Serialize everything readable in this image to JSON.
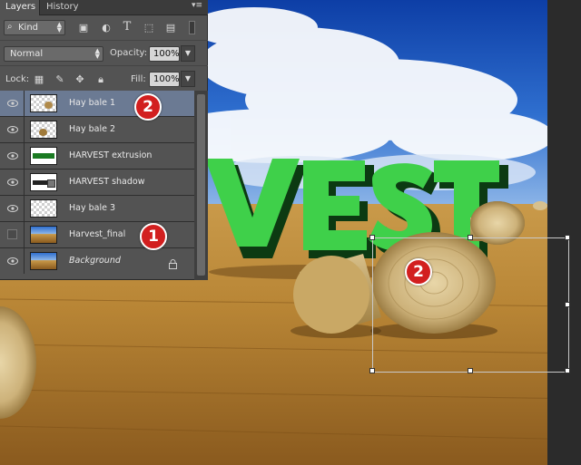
{
  "panel": {
    "tabs": [
      "Layers",
      "History"
    ],
    "menu_icon": "panel-menu-icon",
    "filter_kind": "Kind",
    "blend_mode": "Normal",
    "opacity_label": "Opacity:",
    "opacity_value": "100%",
    "lock_label": "Lock:",
    "fill_label": "Fill:",
    "fill_value": "100%"
  },
  "layers": [
    {
      "name": "Hay bale 1",
      "visible": true,
      "selected": true,
      "thumb": "checker-bale"
    },
    {
      "name": "Hay bale 2",
      "visible": true,
      "selected": false,
      "thumb": "checker-bale"
    },
    {
      "name": "HARVEST extrusion",
      "visible": true,
      "selected": false,
      "thumb": "harvest-green"
    },
    {
      "name": "HARVEST shadow",
      "visible": true,
      "selected": false,
      "thumb": "harvest-dark"
    },
    {
      "name": "Hay bale 3",
      "visible": true,
      "selected": false,
      "thumb": "checker"
    },
    {
      "name": "Harvest_final",
      "visible": false,
      "selected": false,
      "thumb": "photo"
    },
    {
      "name": "Background",
      "visible": true,
      "selected": false,
      "thumb": "photo",
      "locked": true
    }
  ],
  "callouts": [
    "2",
    "1",
    "2"
  ],
  "canvas": {
    "headline": "VEST",
    "headline_color": "#35c83a"
  },
  "colors": {
    "panel_bg": "#535353",
    "selected_row": "#6b7a93",
    "callout": "#d21f1f"
  }
}
